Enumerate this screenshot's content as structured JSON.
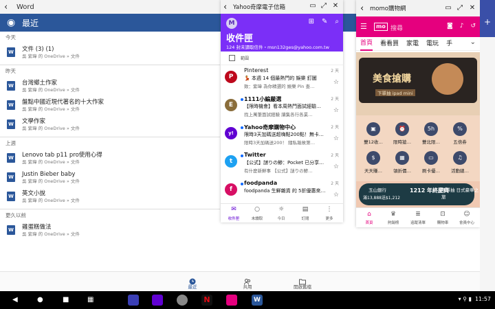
{
  "word": {
    "title": "Word",
    "header_title": "最近",
    "sections": [
      {
        "label": "今天",
        "docs": [
          {
            "name": "文件 (3) (1)",
            "sub": "吳 紫瑋 的 OneDrive » 文件"
          }
        ]
      },
      {
        "label": "昨天",
        "docs": [
          {
            "name": "台灣鄉土作家",
            "sub": "吳 紫瑋 的 OneDrive » 文件"
          },
          {
            "name": "盤點中國近現代著名的十大作家",
            "sub": "吳 紫瑋 的 OneDrive » 文件"
          },
          {
            "name": "文學作家",
            "sub": "吳 紫瑋 的 OneDrive » 文件"
          }
        ]
      },
      {
        "label": "上週",
        "docs": [
          {
            "name": "Lenovo tab p11 pro使用心得",
            "sub": "吳 紫瑋 的 OneDrive » 文件"
          },
          {
            "name": "Justin Bieber baby",
            "sub": "吳 紫瑋 的 OneDrive » 文件"
          },
          {
            "name": "英文小說",
            "sub": "吳 紫瑋 的 OneDrive » 文件"
          }
        ]
      },
      {
        "label": "更久以前",
        "docs": [
          {
            "name": "雞蛋糕做法",
            "sub": "吳 紫瑋 的 OneDrive » 文件"
          }
        ]
      }
    ],
    "tabs": [
      "最近",
      "共用",
      "開啟舊檔"
    ]
  },
  "yahoo": {
    "title": "Yahoo奇摩電子信箱",
    "inbox": "收件匣",
    "meta": "124 封未讀取信件・msn132ges@yahoo.com.tw",
    "select_all": "範圍",
    "mails": [
      {
        "avatar": "P",
        "color": "#bd081c",
        "from": "Pinterest",
        "subject": "💃 本週 14 個最熱門的 娛樂 釘圖",
        "snippet": "致：紫瑋 為你精選的 娛樂 Pin 查…",
        "time": "2 天",
        "bold": false,
        "unread": false
      },
      {
        "avatar": "E",
        "color": "#8a6d3b",
        "from": "1111小編嚴選",
        "subject": "【限時機會】看本周熱門面試經驗…",
        "snippet": "找上萬筆面試經驗 讓集各行各業…",
        "time": "2 天",
        "bold": true,
        "unread": true
      },
      {
        "avatar": "y!",
        "color": "#6001d2",
        "from": "Yahoo奇摩購物中心",
        "subject": "限時3天加碼送超嗨點200點！無卡…",
        "snippet": "限時3天加碼送200！ 隨私報故第…",
        "time": "2 天",
        "bold": true,
        "unread": true
      },
      {
        "avatar": "t",
        "color": "#1da1f2",
        "from": "Twitter",
        "subject": "【公式】謎りの鯵：Pocket 已分享…",
        "snippet": "有什麼新鮮事 【公式】謎りの鯵…",
        "time": "2 天",
        "bold": true,
        "unread": true
      },
      {
        "avatar": "f",
        "color": "#d70f64",
        "from": "foodpanda",
        "subject": "foodpanda 生鮮雜貨 的 5折優惠來…",
        "snippet": "",
        "time": "2 天",
        "bold": true,
        "unread": true
      }
    ],
    "nav": [
      "收件匣",
      "未讀取",
      "今日",
      "訂閱",
      "更多"
    ]
  },
  "momo": {
    "title": "momo購物網",
    "logo": "mo",
    "search_placeholder": "搜尋",
    "tabs": [
      "首頁",
      "看看買",
      "家電",
      "電玩",
      "手"
    ],
    "banner_big": "美食搶購",
    "banner_small": "下單抽 ipad mini",
    "icons": [
      {
        "label": "雙12收…"
      },
      {
        "label": "限時搶…"
      },
      {
        "label": "雙北限…"
      },
      {
        "label": "五倍券"
      },
      {
        "label": "天天賺…"
      },
      {
        "label": "領折價…"
      },
      {
        "label": "刷卡優…"
      },
      {
        "label": "活動總…"
      }
    ],
    "promo_bank": "玉山銀行",
    "promo_amount": "滿13,888送$1,212",
    "promo_fest": "1212 年終慶典",
    "promo_buy": "下單抽 日式豪華之旅",
    "nav": [
      "首頁",
      "熱銷榜",
      "追蹤清單",
      "購物車",
      "會員中心"
    ]
  },
  "system": {
    "time": "11:57"
  }
}
